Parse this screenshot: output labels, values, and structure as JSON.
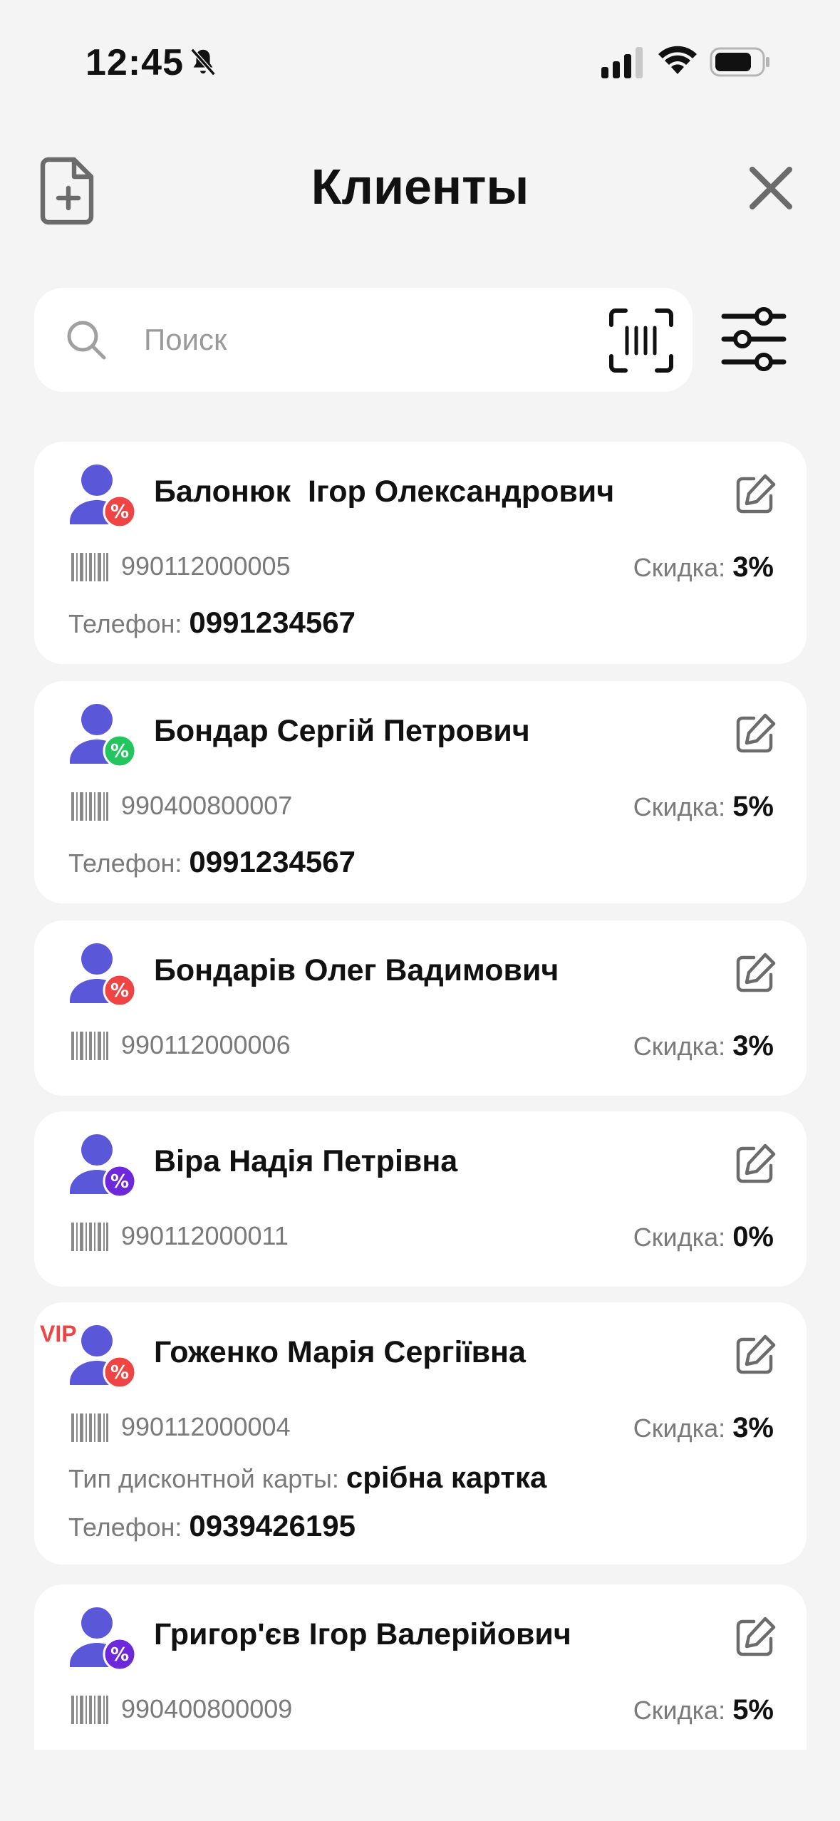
{
  "status_bar": {
    "time": "12:45"
  },
  "header": {
    "title": "Клиенты"
  },
  "search": {
    "placeholder": "Поиск"
  },
  "labels": {
    "discount": "Скидка:",
    "phone": "Телефон:",
    "card_type": "Тип дисконтной карты:"
  },
  "colors": {
    "avatar": "#5a57d8",
    "badge_red": "#ef4444",
    "badge_green": "#22c55e",
    "badge_purple": "#6d28d9",
    "vip": "#ef4444"
  },
  "clients": [
    {
      "name": "Балонюк  Ігор Олександрович",
      "barcode": "990112000005",
      "discount": "3%",
      "phone": "0991234567",
      "badge": "red-percent-badge"
    },
    {
      "name": "Бондар Сергій Петрович",
      "barcode": "990400800007",
      "discount": "5%",
      "phone": "0991234567",
      "badge": "green-percent-badge"
    },
    {
      "name": "Бондарів Олег Вадимович",
      "barcode": "990112000006",
      "discount": "3%",
      "badge": "red-percent-badge"
    },
    {
      "name": "Віра Надія Петрівна",
      "barcode": "990112000011",
      "discount": "0%",
      "badge": "purple-percent-badge"
    },
    {
      "name": "Гоженко Марія Сергіївна",
      "barcode": "990112000004",
      "discount": "3%",
      "vip": "VIP",
      "card_type": "срібна картка",
      "phone": "0939426195",
      "badge": "red-percent-badge"
    },
    {
      "name": "Григор'єв Ігор Валерійович",
      "barcode": "990400800009",
      "discount": "5%",
      "badge": "purple-percent-badge"
    }
  ]
}
